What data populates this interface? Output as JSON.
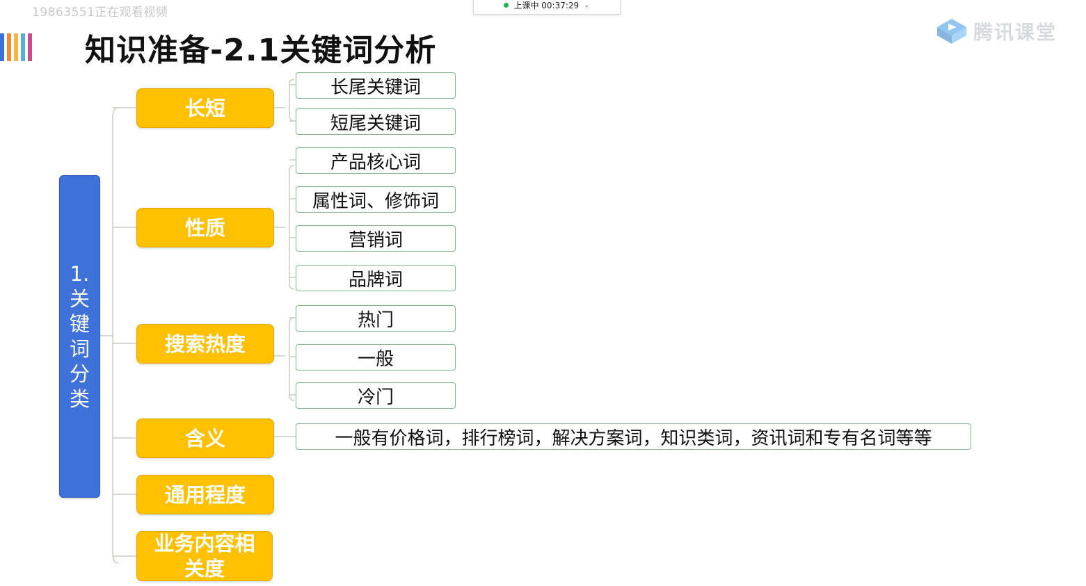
{
  "overlay": {
    "watermark": "19863551正在观看视频",
    "status_text": "上课中 00:37:29",
    "brand_text": "腾讯课堂"
  },
  "colors": {
    "root": "#3f72d9",
    "category": "#ffc000",
    "leaf_border": "#7fb48a",
    "stripes": [
      "#3f72d9",
      "#f08a3c",
      "#f2b64b",
      "#5aaed6",
      "#c94c8b"
    ]
  },
  "slide": {
    "title": "知识准备-2.1关键词分析",
    "root": "1.关键词分类",
    "categories": [
      {
        "label": "长短",
        "items": [
          "长尾关键词",
          "短尾关键词"
        ]
      },
      {
        "label": "性质",
        "items": [
          "产品核心词",
          "属性词、修饰词",
          "营销词",
          "品牌词"
        ]
      },
      {
        "label": "搜索热度",
        "items": [
          "热门",
          "一般",
          "冷门"
        ]
      },
      {
        "label": "含义",
        "items": [
          "一般有价格词，排行榜词，解决方案词，知识类词，资讯词和专有名词等等"
        ]
      },
      {
        "label": "通用程度",
        "items": []
      },
      {
        "label": "业务内容相关度",
        "items": []
      }
    ]
  }
}
